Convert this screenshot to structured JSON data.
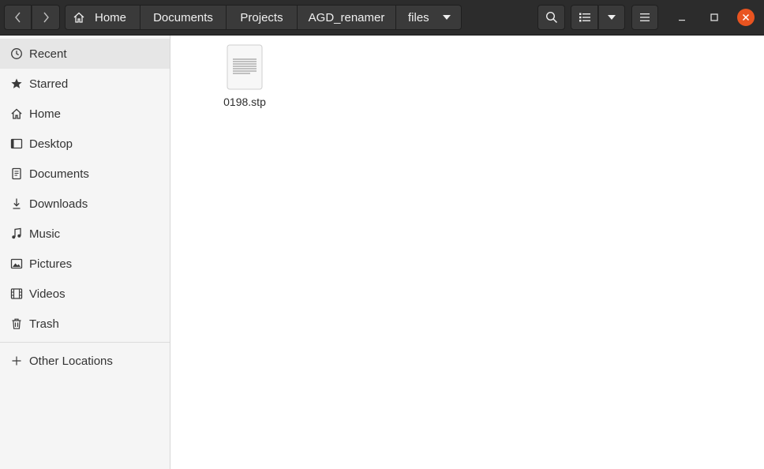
{
  "header": {
    "breadcrumbs": [
      "Home",
      "Documents",
      "Projects",
      "AGD_renamer",
      "files"
    ]
  },
  "sidebar": {
    "items": [
      {
        "label": "Recent",
        "icon": "clock-icon",
        "active": true
      },
      {
        "label": "Starred",
        "icon": "star-icon"
      },
      {
        "label": "Home",
        "icon": "home-icon"
      },
      {
        "label": "Desktop",
        "icon": "desktop-icon"
      },
      {
        "label": "Documents",
        "icon": "document-icon"
      },
      {
        "label": "Downloads",
        "icon": "download-icon"
      },
      {
        "label": "Music",
        "icon": "music-note-icon"
      },
      {
        "label": "Pictures",
        "icon": "picture-icon"
      },
      {
        "label": "Videos",
        "icon": "film-icon"
      },
      {
        "label": "Trash",
        "icon": "trash-icon"
      }
    ],
    "other_locations": "Other Locations"
  },
  "files": [
    {
      "name": "0198.stp",
      "icon": "text-file-icon"
    }
  ],
  "colors": {
    "headerbar": "#2c2c2c",
    "close_button": "#e95420",
    "sidebar": "#f5f5f5",
    "sidebar_active": "#e6e6e6"
  }
}
